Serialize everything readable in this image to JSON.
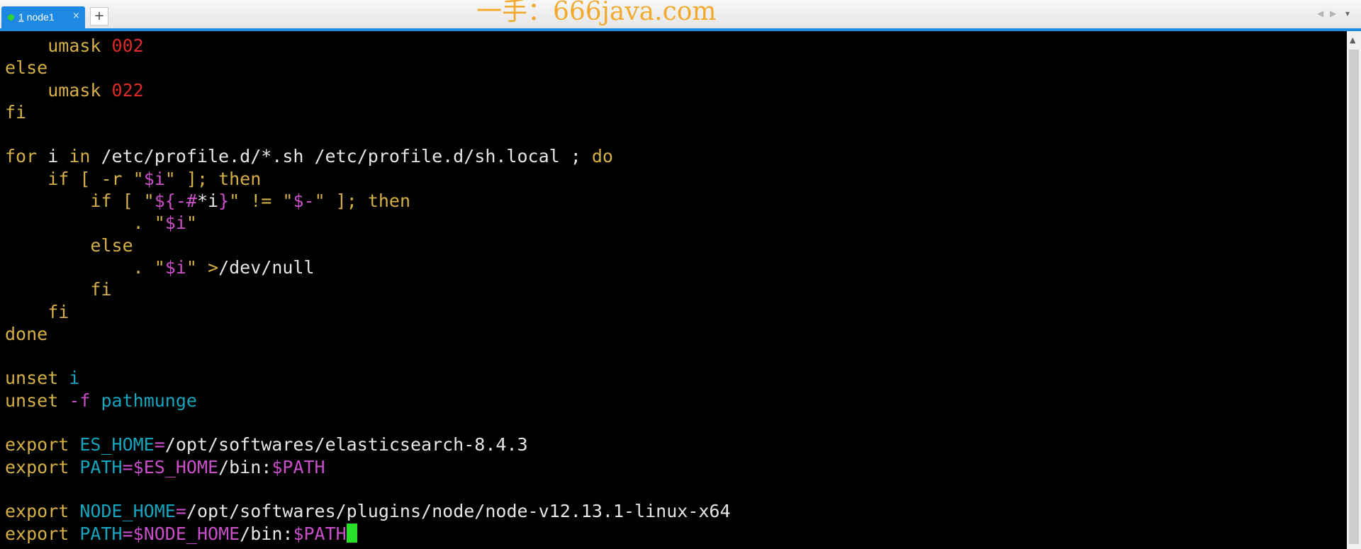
{
  "tab": {
    "number": "1",
    "name": "node1",
    "close": "×"
  },
  "new_tab_label": "+",
  "watermark": "一手：666java.com",
  "tab_nav": {
    "left": "◀",
    "right": "▶",
    "menu": "▾"
  },
  "scroll": {
    "up": "▲"
  },
  "colors": {
    "tab_active": "#1e88e5",
    "terminal_bg": "#000000",
    "text": "#e6e6e6",
    "keyword": "#d4b046",
    "number": "#dd2a2a",
    "variable": "#c94fc9",
    "identifier": "#15a5be",
    "cursor": "#27e027",
    "watermark": "#f2aa2e"
  },
  "terminal_lines": [
    [
      [
        "    ",
        "tx"
      ],
      [
        "umask",
        "kw"
      ],
      [
        " ",
        "tx"
      ],
      [
        "002",
        "num"
      ]
    ],
    [
      [
        "else",
        "kw"
      ]
    ],
    [
      [
        "    ",
        "tx"
      ],
      [
        "umask",
        "kw"
      ],
      [
        " ",
        "tx"
      ],
      [
        "022",
        "num"
      ]
    ],
    [
      [
        "fi",
        "kw"
      ]
    ],
    [],
    [
      [
        "for",
        "kw"
      ],
      [
        " i ",
        "tx"
      ],
      [
        "in",
        "kw"
      ],
      [
        " /etc/profile.d/*.sh /etc/profile.d/sh.local ; ",
        "tx"
      ],
      [
        "do",
        "kw"
      ]
    ],
    [
      [
        "    ",
        "tx"
      ],
      [
        "if",
        "kw"
      ],
      [
        " [ -r \"",
        "kw"
      ],
      [
        "$i",
        "var"
      ],
      [
        "\" ]; ",
        "kw"
      ],
      [
        "then",
        "kw"
      ]
    ],
    [
      [
        "        ",
        "tx"
      ],
      [
        "if",
        "kw"
      ],
      [
        " [ \"",
        "kw"
      ],
      [
        "${-#",
        "var"
      ],
      [
        "*i",
        "tx"
      ],
      [
        "}",
        "var"
      ],
      [
        "\" != \"",
        "kw"
      ],
      [
        "$-",
        "var"
      ],
      [
        "\" ]; ",
        "kw"
      ],
      [
        "then",
        "kw"
      ]
    ],
    [
      [
        "            ",
        "tx"
      ],
      [
        ". \"",
        "kw"
      ],
      [
        "$i",
        "var"
      ],
      [
        "\"",
        "kw"
      ]
    ],
    [
      [
        "        ",
        "tx"
      ],
      [
        "else",
        "kw"
      ]
    ],
    [
      [
        "            ",
        "tx"
      ],
      [
        ". \"",
        "kw"
      ],
      [
        "$i",
        "var"
      ],
      [
        "\" ",
        "kw"
      ],
      [
        ">",
        "kw"
      ],
      [
        "/dev/null",
        "tx"
      ]
    ],
    [
      [
        "        ",
        "tx"
      ],
      [
        "fi",
        "kw"
      ]
    ],
    [
      [
        "    ",
        "tx"
      ],
      [
        "fi",
        "kw"
      ]
    ],
    [
      [
        "done",
        "kw"
      ]
    ],
    [],
    [
      [
        "unset",
        "kw"
      ],
      [
        " ",
        "tx"
      ],
      [
        "i",
        "cy"
      ]
    ],
    [
      [
        "unset",
        "kw"
      ],
      [
        " ",
        "tx"
      ],
      [
        "-f",
        "var"
      ],
      [
        " ",
        "tx"
      ],
      [
        "pathmunge",
        "cy"
      ]
    ],
    [],
    [
      [
        "export",
        "kw"
      ],
      [
        " ",
        "tx"
      ],
      [
        "ES_HOME",
        "cy"
      ],
      [
        "=",
        "var"
      ],
      [
        "/opt/softwares/elasticsearch-8.4.3",
        "tx"
      ]
    ],
    [
      [
        "export",
        "kw"
      ],
      [
        " ",
        "tx"
      ],
      [
        "PATH",
        "cy"
      ],
      [
        "=",
        "var"
      ],
      [
        "$ES_HOME",
        "var"
      ],
      [
        "/bin:",
        "tx"
      ],
      [
        "$PATH",
        "var"
      ]
    ],
    [],
    [
      [
        "export",
        "kw"
      ],
      [
        " ",
        "tx"
      ],
      [
        "NODE_HOME",
        "cy"
      ],
      [
        "=",
        "var"
      ],
      [
        "/opt/softwares/plugins/node/node-v12.13.1-linux-x64",
        "tx"
      ]
    ],
    [
      [
        "export",
        "kw"
      ],
      [
        " ",
        "tx"
      ],
      [
        "PATH",
        "cy"
      ],
      [
        "=",
        "var"
      ],
      [
        "$NODE_HOME",
        "var"
      ],
      [
        "/bin:",
        "tx"
      ],
      [
        "$PATH",
        "var"
      ]
    ]
  ]
}
